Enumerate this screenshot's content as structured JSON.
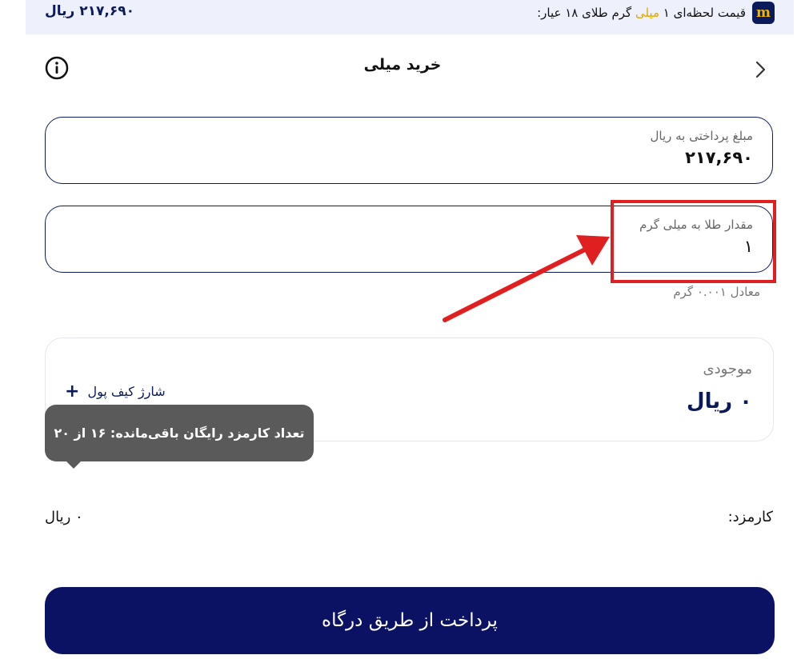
{
  "banner": {
    "price": "۲۱۷,۶۹۰ ریال",
    "text_before": "قیمت لحظه‌ای ۱ ",
    "text_highlight": "میلی",
    "text_after": " گرم طلای ۱۸ عیار:",
    "brand_letter": "m",
    "brand_color": "#0b1a5b",
    "highlight_color": "#e3a600"
  },
  "header": {
    "title": "خرید میلی",
    "info_icon": "info-icon",
    "back_icon": "chevron-right-icon"
  },
  "payment_field": {
    "label": "مبلغ پرداختی به ریال",
    "value": "۲۱۷,۶۹۰"
  },
  "gold_field": {
    "label": "مقدار طلا به میلی گرم",
    "value": "۱",
    "equivalent": "معادل ۰.۰۰۱ گرم"
  },
  "balance": {
    "label": "موجودی",
    "value": "۰ ریال",
    "charge_label": "شارژ کیف پول"
  },
  "tooltip": {
    "text": "تعداد کارمزد رایگان باقی‌مانده: ۱۶ از ۲۰"
  },
  "fee": {
    "label": "کارمزد:",
    "value": "۰ ریال"
  },
  "pay_button": {
    "label": "پرداخت از طریق درگاه",
    "color": "#0b1263"
  },
  "annotation": {
    "color": "#e02020"
  }
}
